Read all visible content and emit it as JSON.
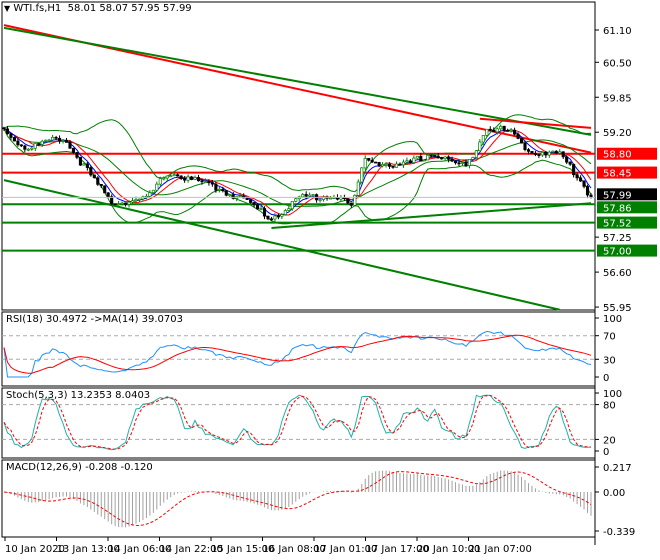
{
  "header": {
    "symbol": "WTI.fs,H1",
    "ohlc": "58.01 58.07 57.95 57.99",
    "menu_icon": "triangle-down-icon"
  },
  "colors": {
    "bull": "#008000",
    "bear": "#000000",
    "resistance": "#ff0000",
    "support": "#008000",
    "bands": "#008000",
    "ma_fast": "#0000ff",
    "ma_slow": "#ff0000",
    "rsi": "#1e90ff",
    "stoch_main": "#20b2aa",
    "signal": "#ff0000"
  },
  "chart_data": [
    {
      "type": "candlestick",
      "title": "WTI.fs,H1",
      "price_axis": {
        "ticks": [
          "61.10",
          "60.50",
          "59.85",
          "59.20",
          "57.25",
          "56.60",
          "55.95"
        ],
        "range": [
          55.9,
          61.6
        ]
      },
      "time_axis": {
        "ticks": [
          "10 Jan 2020",
          "13 Jan 13:00",
          "14 Jan 06:00",
          "14 Jan 22:00",
          "15 Jan 15:00",
          "16 Jan 08:00",
          "17 Jan 01:00",
          "17 Jan 17:00",
          "20 Jan 10:00",
          "21 Jan 07:00"
        ],
        "bars": 170
      },
      "close_keypoints": [
        [
          0,
          59.25
        ],
        [
          6,
          58.9
        ],
        [
          17,
          59.1
        ],
        [
          26,
          58.3
        ],
        [
          31,
          57.9
        ],
        [
          41,
          57.95
        ],
        [
          47,
          58.45
        ],
        [
          60,
          58.2
        ],
        [
          69,
          57.95
        ],
        [
          77,
          57.6
        ],
        [
          86,
          58.0
        ],
        [
          97,
          58.0
        ],
        [
          100,
          57.8
        ],
        [
          104,
          58.7
        ],
        [
          114,
          58.55
        ],
        [
          123,
          58.8
        ],
        [
          133,
          58.55
        ],
        [
          139,
          59.3
        ],
        [
          146,
          59.2
        ],
        [
          151,
          58.85
        ],
        [
          160,
          58.8
        ],
        [
          166,
          58.3
        ],
        [
          169,
          57.99
        ]
      ],
      "current_price": "57.99",
      "levels": [
        {
          "label": "58.80",
          "price": 58.8,
          "color": "#ff0000"
        },
        {
          "label": "58.45",
          "price": 58.45,
          "color": "#ff0000"
        },
        {
          "label": "57.86",
          "price": 57.86,
          "color": "#008000"
        },
        {
          "label": "57.52",
          "price": 57.52,
          "color": "#008000"
        },
        {
          "label": "57.00",
          "price": 57.0,
          "color": "#008000"
        }
      ],
      "trendlines": [
        {
          "color": "#ff0000",
          "from": [
            0,
            61.19
          ],
          "to": [
            169,
            58.82
          ]
        },
        {
          "color": "#008000",
          "from": [
            0,
            61.14
          ],
          "to": [
            169,
            59.15
          ]
        },
        {
          "color": "#ff0000",
          "from": [
            137,
            59.45
          ],
          "to": [
            169,
            59.28
          ]
        },
        {
          "color": "#008000",
          "from": [
            0,
            58.31
          ],
          "to": [
            160,
            55.9
          ]
        },
        {
          "color": "#008000",
          "from": [
            77,
            57.42
          ],
          "to": [
            169,
            57.88
          ]
        }
      ]
    },
    {
      "type": "line",
      "title": "RSI(18) 30.4972  ->MA(14) 39.0703",
      "ticks": [
        "100",
        "70",
        "30",
        "0"
      ],
      "ylim": [
        0,
        100
      ],
      "levels": [
        70,
        30
      ]
    },
    {
      "type": "line",
      "title": "Stoch(5,3,3) 13.2353 8.0403",
      "ticks": [
        "100",
        "80",
        "20",
        "0"
      ],
      "ylim": [
        0,
        100
      ],
      "levels": [
        80,
        20
      ]
    },
    {
      "type": "bar",
      "title": "MACD(12,26,9) -0.208 -0.120",
      "ticks": [
        "0.217",
        "0.00",
        "-0.339"
      ],
      "ylim": [
        -0.339,
        0.217
      ]
    }
  ]
}
